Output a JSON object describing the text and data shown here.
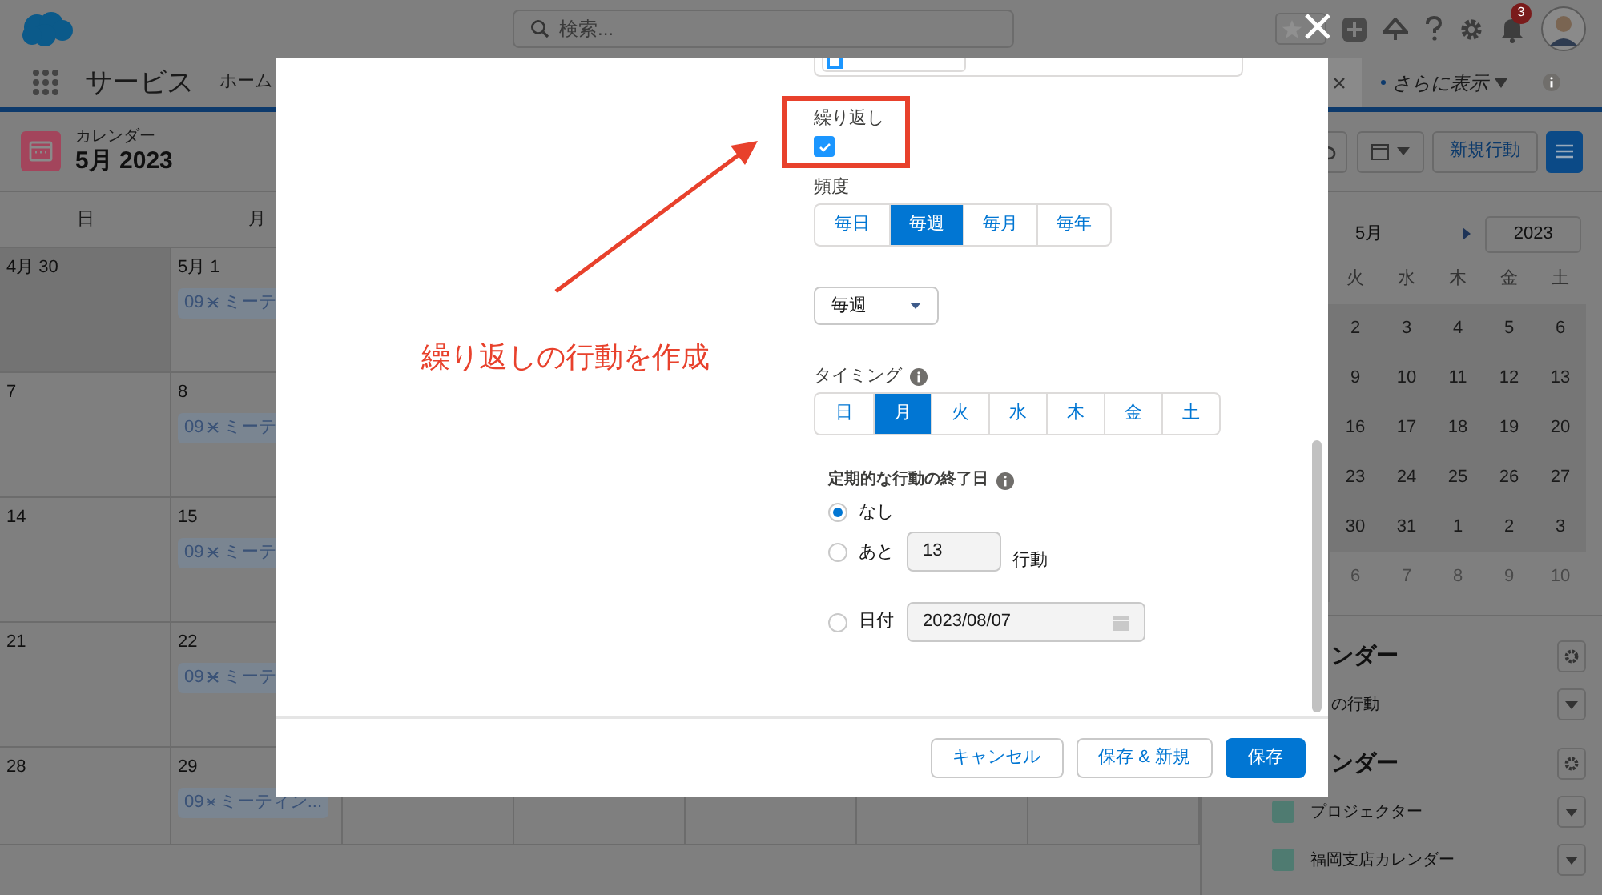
{
  "header": {
    "search": {
      "placeholder": "検索..."
    },
    "notification_count": "3"
  },
  "nav": {
    "app_name": "サービス",
    "items": [
      "ホーム"
    ],
    "more": "さらに表示"
  },
  "calendar": {
    "subtitle": "カレンダー",
    "title": "5月 2023",
    "new_button": "新規行動",
    "weekdays": [
      "日",
      "月"
    ],
    "weeks": [
      {
        "cells": [
          {
            "date": "4月 30",
            "other_month": true
          },
          {
            "date": "5月 1",
            "other_month": false,
            "event": {
              "time": "09",
              "title": "ミーテ"
            }
          }
        ]
      },
      {
        "cells": [
          {
            "date": "7",
            "other_month": false
          },
          {
            "date": "8",
            "other_month": false,
            "event": {
              "time": "09",
              "title": "ミーテ"
            }
          }
        ]
      },
      {
        "cells": [
          {
            "date": "14",
            "other_month": false
          },
          {
            "date": "15",
            "other_month": false,
            "event": {
              "time": "09",
              "title": "ミーテ"
            }
          }
        ]
      },
      {
        "cells": [
          {
            "date": "21",
            "other_month": false
          },
          {
            "date": "22",
            "other_month": false,
            "event": {
              "time": "09",
              "title": "ミーテ"
            }
          }
        ]
      },
      {
        "cells": [
          {
            "date": "28",
            "other_month": false
          },
          {
            "date": "29",
            "other_month": false,
            "event": {
              "time": "09",
              "title": "ミーティン..."
            }
          }
        ]
      }
    ]
  },
  "mini_calendar": {
    "month": "5月",
    "year": "2023",
    "weekdays": [
      "火",
      "水",
      "木",
      "金",
      "土"
    ],
    "weeks": [
      {
        "days": [
          "2",
          "3",
          "4",
          "5",
          "6"
        ],
        "dimmed": false
      },
      {
        "days": [
          "9",
          "10",
          "11",
          "12",
          "13"
        ],
        "dimmed": false
      },
      {
        "days": [
          "16",
          "17",
          "18",
          "19",
          "20"
        ],
        "dimmed": false
      },
      {
        "days": [
          "23",
          "24",
          "25",
          "26",
          "27"
        ],
        "dimmed": false
      },
      {
        "days": [
          "30",
          "31",
          "1",
          "2",
          "3"
        ],
        "dimmed": false
      },
      {
        "days": [
          "6",
          "7",
          "8",
          "9",
          "10"
        ],
        "dimmed": true
      }
    ]
  },
  "calendar_lists": [
    {
      "title": "ンダー",
      "items": [
        {
          "label": "の行動"
        }
      ]
    },
    {
      "title": "ンダー",
      "items": [
        {
          "label": "プロジェクター",
          "color": "#4f7b71"
        },
        {
          "label": "福岡支店カレンダー",
          "color": "#4f7b71"
        }
      ]
    }
  ],
  "dialog": {
    "recurrence": {
      "label": "繰り返し",
      "checked": true
    },
    "frequency": {
      "label": "頻度",
      "options": [
        {
          "label": "毎日",
          "selected": false
        },
        {
          "label": "毎週",
          "selected": true
        },
        {
          "label": "毎月",
          "selected": false
        },
        {
          "label": "毎年",
          "selected": false
        }
      ]
    },
    "interval": {
      "value": "毎週"
    },
    "timing": {
      "label": "タイミング",
      "days": [
        {
          "label": "日",
          "selected": false
        },
        {
          "label": "月",
          "selected": true
        },
        {
          "label": "火",
          "selected": false
        },
        {
          "label": "水",
          "selected": false
        },
        {
          "label": "木",
          "selected": false
        },
        {
          "label": "金",
          "selected": false
        },
        {
          "label": "土",
          "selected": false
        }
      ]
    },
    "end": {
      "label": "定期的な行動の終了日",
      "options": [
        {
          "kind": "none",
          "label": "なし",
          "selected": true
        },
        {
          "kind": "count",
          "label": "あと",
          "value": "13",
          "suffix": "行動",
          "selected": false
        },
        {
          "kind": "date",
          "label": "日付",
          "value": "2023/08/07",
          "selected": false
        }
      ]
    },
    "buttons": [
      {
        "label": "キャンセル",
        "primary": false
      },
      {
        "label": "保存 & 新規",
        "primary": false
      },
      {
        "label": "保存",
        "primary": true
      }
    ]
  },
  "annotation": {
    "text": "繰り返しの行動を作成"
  }
}
